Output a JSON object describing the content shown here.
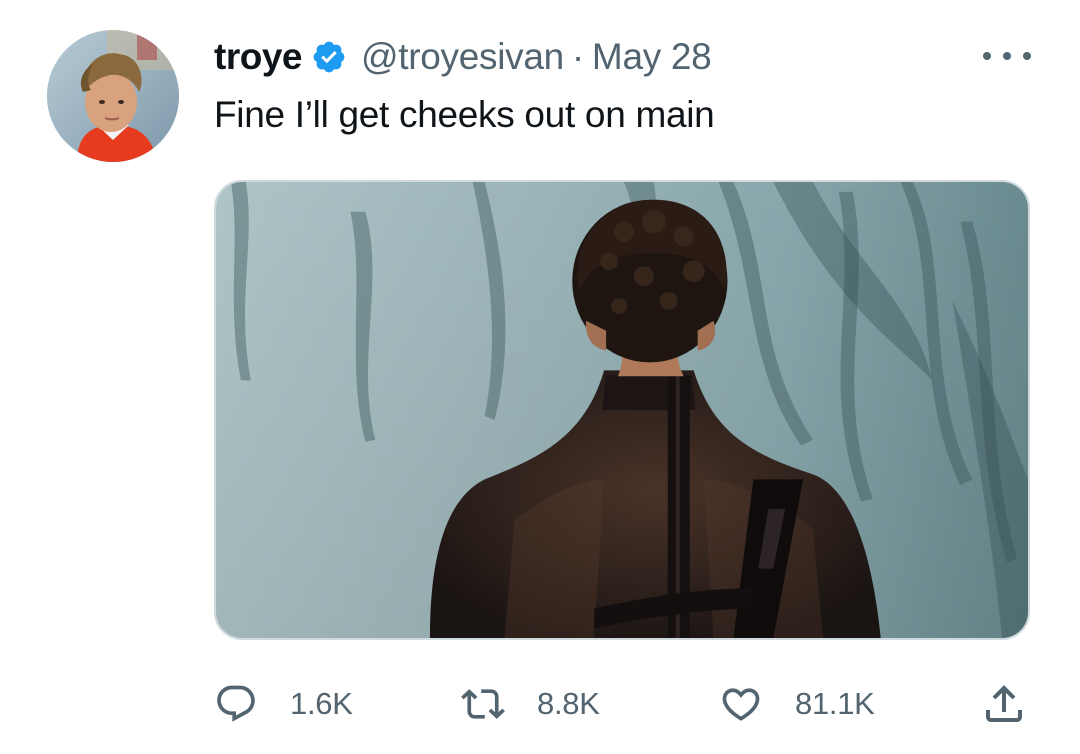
{
  "tweet": {
    "display_name": "troye",
    "verified": true,
    "handle": "@troyesivan",
    "separator": "·",
    "date": "May 28",
    "text": "Fine I’ll get cheeks out on main",
    "stats": {
      "replies": "1.6K",
      "retweets": "8.8K",
      "likes": "81.1K"
    }
  },
  "colors": {
    "text_primary": "#0f1419",
    "text_secondary": "#536471",
    "verified_blue": "#1d9bf0",
    "media_border": "#cfd9de"
  },
  "icons": {
    "verified": "verified-badge-icon",
    "more": "more-horizontal-icon",
    "reply": "reply-bubble-icon",
    "retweet": "retweet-arrows-icon",
    "like": "heart-outline-icon",
    "share": "share-upload-icon"
  }
}
